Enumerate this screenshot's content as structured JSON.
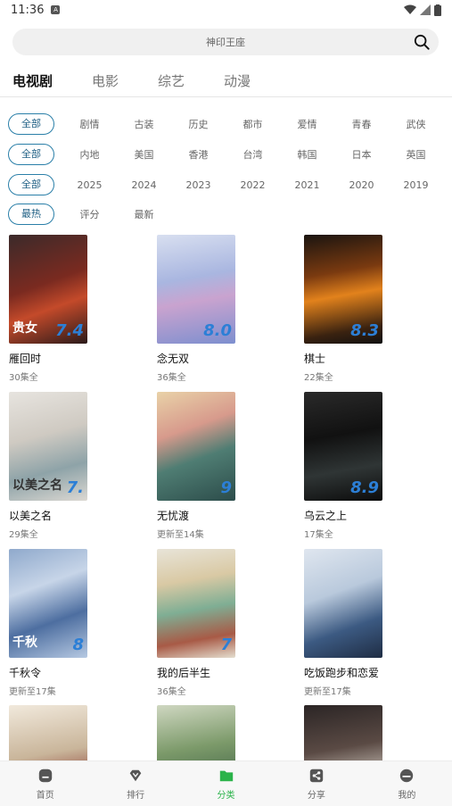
{
  "status": {
    "time": "11:36"
  },
  "search": {
    "placeholder": "神印王座"
  },
  "tabs": [
    {
      "label": "电视剧"
    },
    {
      "label": "电影"
    },
    {
      "label": "综艺"
    },
    {
      "label": "动漫"
    }
  ],
  "filters": {
    "genre": [
      "全部",
      "剧情",
      "古装",
      "历史",
      "都市",
      "爱情",
      "青春",
      "武侠"
    ],
    "region": [
      "全部",
      "内地",
      "美国",
      "香港",
      "台湾",
      "韩国",
      "日本",
      "英国"
    ],
    "year": [
      "全部",
      "2025",
      "2024",
      "2023",
      "2022",
      "2021",
      "2020",
      "2019"
    ],
    "sort": [
      "最热",
      "评分",
      "最新"
    ]
  },
  "items": [
    {
      "title": "雁回时",
      "sub": "30集全",
      "rating": "7.4",
      "poster_text": "贵女"
    },
    {
      "title": "念无双",
      "sub": "36集全",
      "rating": "8.0",
      "poster_text": ""
    },
    {
      "title": "棋士",
      "sub": "22集全",
      "rating": "8.3",
      "poster_text": ""
    },
    {
      "title": "以美之名",
      "sub": "29集全",
      "rating": "7.",
      "poster_text": "以美之名"
    },
    {
      "title": "无忧渡",
      "sub": "更新至14集",
      "rating": "9",
      "poster_text": ""
    },
    {
      "title": "乌云之上",
      "sub": "17集全",
      "rating": "8.9",
      "poster_text": ""
    },
    {
      "title": "千秋令",
      "sub": "更新至17集",
      "rating": "8",
      "poster_text": "千秋"
    },
    {
      "title": "我的后半生",
      "sub": "36集全",
      "rating": "7",
      "poster_text": ""
    },
    {
      "title": "吃饭跑步和恋爱",
      "sub": "更新至17集",
      "rating": "",
      "poster_text": ""
    },
    {
      "title": "",
      "sub": "",
      "rating": "",
      "poster_text": ""
    },
    {
      "title": "",
      "sub": "",
      "rating": "",
      "poster_text": ""
    },
    {
      "title": "",
      "sub": "",
      "rating": "",
      "poster_text": ""
    }
  ],
  "nav": [
    {
      "label": "首页"
    },
    {
      "label": "排行"
    },
    {
      "label": "分类"
    },
    {
      "label": "分享"
    },
    {
      "label": "我的"
    }
  ],
  "colors": {
    "accent": "#2bb34a",
    "chip_border": "#2a7fa8",
    "rating": "#2c7fd6"
  }
}
